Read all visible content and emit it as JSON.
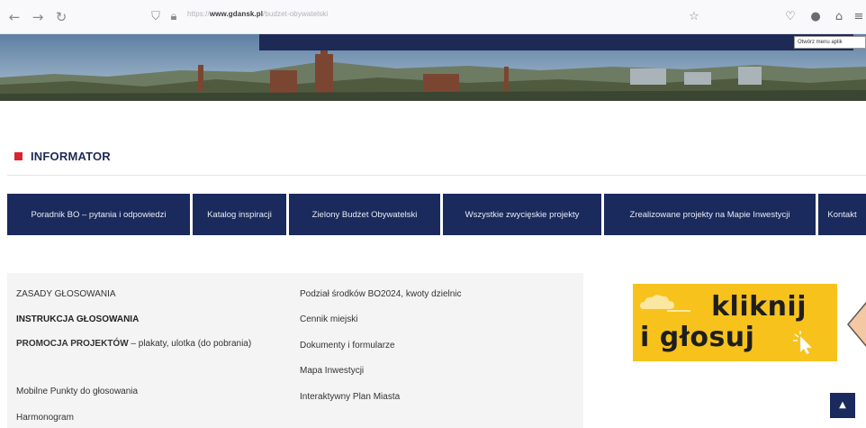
{
  "browser": {
    "back_icon": "arrow-left-icon",
    "forward_icon": "arrow-right-icon",
    "reload_icon": "reload-icon",
    "url_prefix": "https://",
    "url_domain": "www.gdansk.pl",
    "url_path": "/budzet-obywatelski",
    "bookmark_icon": "star-icon",
    "tooltip": "Otwórz menu aplik"
  },
  "informator": {
    "title": "INFORMATOR",
    "accent": "#d9232e"
  },
  "nav_buttons": [
    {
      "label": "Poradnik BO – pytania i odpowiedzi"
    },
    {
      "label": "Katalog inspiracji"
    },
    {
      "label": "Zielony Budżet Obywatelski"
    },
    {
      "label": "Wszystkie zwycięskie projekty"
    },
    {
      "label": "Zrealizowane projekty na Mapie Inwestycji"
    },
    {
      "label": "Kontakt"
    }
  ],
  "left_links": [
    {
      "label": "ZASADY GŁOSOWANIA"
    },
    {
      "label": "INSTRUKCJA GŁOSOWANIA"
    },
    {
      "label_bold": "PROMOCJA PROJEKTÓW",
      "label_rest": " – plakaty, ulotka (do pobrania)"
    },
    {
      "label": "Mobilne Punkty do głosowania"
    },
    {
      "label": "Harmonogram"
    }
  ],
  "right_links": [
    {
      "label": "Podział środków BO2024, kwoty dzielnic"
    },
    {
      "label": "Cennik miejski"
    },
    {
      "label": "Dokumenty i formularze"
    },
    {
      "label": "Mapa Inwestycji"
    },
    {
      "label": "Interaktywny Plan Miasta"
    }
  ],
  "vote_banner": {
    "line1": "kliknij",
    "line2": "i głosuj",
    "color": "#f7c21c"
  },
  "colors": {
    "navy": "#1b2a5c"
  }
}
